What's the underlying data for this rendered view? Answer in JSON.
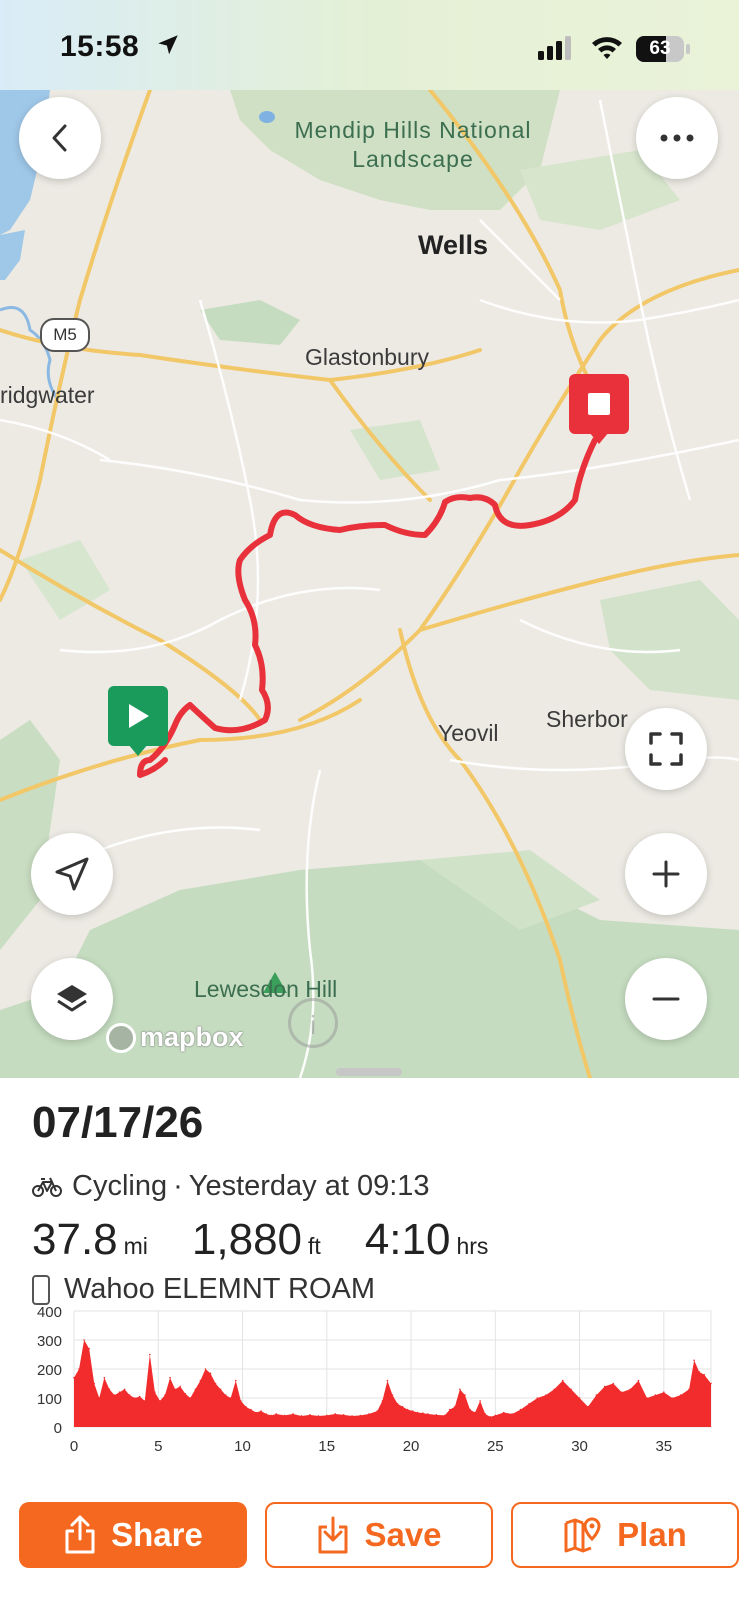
{
  "status_bar": {
    "time": "15:58",
    "battery": "63",
    "battery_level": 0.63
  },
  "map": {
    "places": {
      "national_park": "Mendip Hills National Landscape",
      "wells": "Wells",
      "glastonbury": "Glastonbury",
      "bridgwater": "ridgwater",
      "yeovil": "Yeovil",
      "sherborne": "Sherbor",
      "hill": "Lewesdon Hill"
    },
    "road_shield": "M5",
    "attribution": "mapbox",
    "info_icon_text": "i",
    "route_color": "#e8313a",
    "start_marker_color": "#1a9b5b",
    "end_marker_color": "#e8313a"
  },
  "activity": {
    "date": "07/17/26",
    "type": "Cycling",
    "when": "Yesterday at 09:13",
    "distance": "37.8",
    "distance_unit": "mi",
    "elevation": "1,880",
    "elevation_unit": "ft",
    "duration": "4:10",
    "duration_unit": "hrs",
    "device": "Wahoo ELEMNT ROAM"
  },
  "chart_data": {
    "type": "area",
    "title": "",
    "xlabel": "",
    "ylabel": "",
    "xlim": [
      0,
      37.8
    ],
    "ylim": [
      0,
      400
    ],
    "x_ticks": [
      0,
      5,
      10,
      15,
      20,
      25,
      30,
      35
    ],
    "y_ticks": [
      0,
      100,
      200,
      300,
      400
    ],
    "grid": true,
    "color": "#f22c2c",
    "series": [
      {
        "x": [
          0,
          0.3,
          0.6,
          0.9,
          1.2,
          1.5,
          1.8,
          2.1,
          2.4,
          2.7,
          3.0,
          3.3,
          3.6,
          3.9,
          4.2,
          4.5,
          4.8,
          5.1,
          5.4,
          5.7,
          6.0,
          6.3,
          6.6,
          6.9,
          7.2,
          7.5,
          7.8,
          8.1,
          8.4,
          8.7,
          9.0,
          9.3,
          9.6,
          9.9,
          10.2,
          10.5,
          10.8,
          11.1,
          11.4,
          11.7,
          12,
          12.5,
          13,
          13.5,
          14,
          14.5,
          15,
          15.5,
          16,
          16.5,
          17,
          17.5,
          18,
          18.3,
          18.6,
          18.9,
          19.2,
          19.5,
          19.8,
          20.1,
          20.4,
          20.7,
          21,
          21.5,
          22,
          22.3,
          22.6,
          22.9,
          23.2,
          23.5,
          23.8,
          24.1,
          24.4,
          24.7,
          25,
          25.5,
          26,
          26.5,
          27,
          27.5,
          28,
          28.5,
          29,
          29.5,
          30,
          30.5,
          31,
          31.5,
          32,
          32.5,
          33,
          33.5,
          34,
          34.5,
          35,
          35.5,
          36,
          36.5,
          36.8,
          37.1,
          37.4,
          37.8
        ],
        "y": [
          170,
          200,
          300,
          270,
          150,
          100,
          170,
          130,
          110,
          120,
          130,
          110,
          100,
          105,
          90,
          250,
          120,
          90,
          110,
          170,
          130,
          140,
          115,
          100,
          130,
          160,
          200,
          185,
          150,
          130,
          110,
          100,
          160,
          90,
          70,
          60,
          50,
          55,
          45,
          40,
          45,
          40,
          45,
          38,
          42,
          38,
          40,
          45,
          42,
          38,
          40,
          45,
          55,
          90,
          160,
          110,
          80,
          70,
          60,
          55,
          50,
          48,
          45,
          42,
          40,
          60,
          70,
          130,
          110,
          60,
          50,
          90,
          45,
          35,
          40,
          50,
          45,
          60,
          80,
          100,
          110,
          130,
          160,
          130,
          100,
          70,
          110,
          140,
          150,
          120,
          130,
          160,
          100,
          110,
          120,
          100,
          110,
          130,
          230,
          190,
          180,
          150
        ]
      }
    ]
  },
  "actions": {
    "share": "Share",
    "save": "Save",
    "plan": "Plan"
  }
}
